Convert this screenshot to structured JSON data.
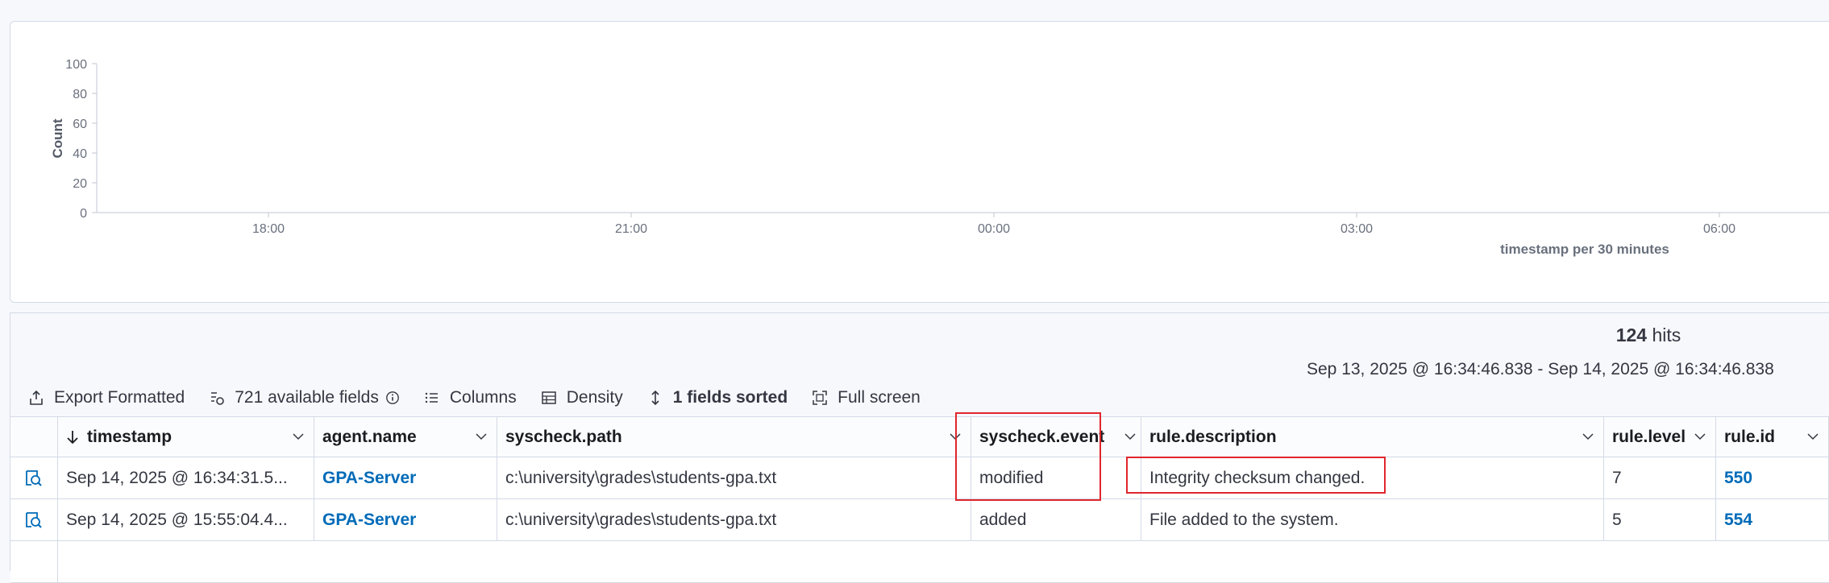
{
  "chart_data": {
    "type": "bar",
    "ylabel": "Count",
    "xlabel": "timestamp per 30 minutes",
    "ylim": [
      0,
      100
    ],
    "yticks": [
      "0",
      "20",
      "40",
      "60",
      "80",
      "100"
    ],
    "xticks": [
      "18:00",
      "21:00",
      "00:00",
      "03:00",
      "06:00"
    ],
    "values": []
  },
  "results": {
    "hits_count": "124",
    "hits_label": "hits",
    "range": "Sep 13, 2025 @ 16:34:46.838 - Sep 14, 2025 @ 16:34:46.838"
  },
  "toolbar": {
    "export": "Export Formatted",
    "fields": "721 available fields",
    "columns": "Columns",
    "density": "Density",
    "sorted": "1 fields sorted",
    "fullscreen": "Full screen"
  },
  "table": {
    "headers": {
      "timestamp": "timestamp",
      "agent": "agent.name",
      "path": "syscheck.path",
      "event": "syscheck.event",
      "description": "rule.description",
      "level": "rule.level",
      "id": "rule.id"
    },
    "rows": [
      {
        "timestamp": "Sep 14, 2025 @ 16:34:31.5...",
        "agent": "GPA-Server",
        "path": "c:\\university\\grades\\students-gpa.txt",
        "event": "modified",
        "description": "Integrity checksum changed.",
        "level": "7",
        "id": "550"
      },
      {
        "timestamp": "Sep 14, 2025 @ 15:55:04.4...",
        "agent": "GPA-Server",
        "path": "c:\\university\\grades\\students-gpa.txt",
        "event": "added",
        "description": "File added to the system.",
        "level": "5",
        "id": "554"
      }
    ]
  },
  "colors": {
    "link": "#006bb8",
    "highlight": "#e0262c",
    "border": "#d3dae6"
  },
  "icons": [
    "share-icon",
    "fields-icon",
    "info-icon",
    "list-icon",
    "table-icon",
    "sort-icon",
    "fullscreen-icon",
    "inspect-icon",
    "chevron-down-icon",
    "arrow-down-icon"
  ]
}
